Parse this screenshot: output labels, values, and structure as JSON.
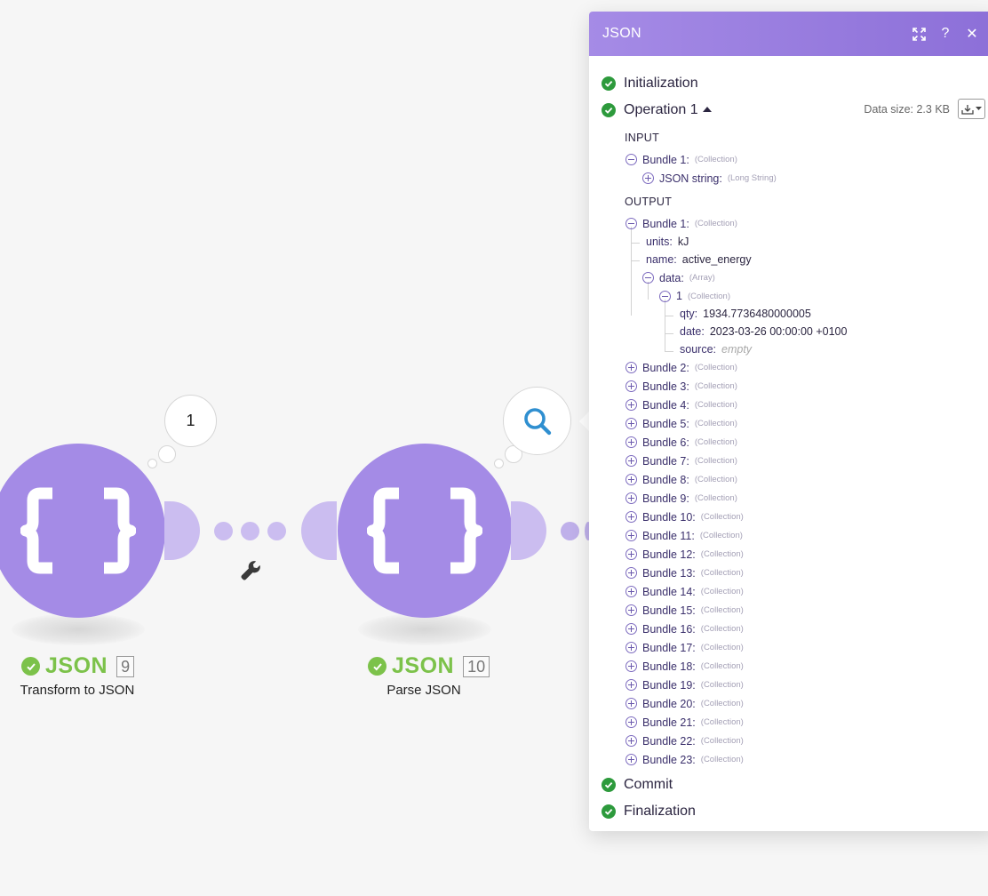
{
  "canvas": {
    "module1": {
      "title": "JSON",
      "id": "9",
      "subtitle": "Transform to JSON",
      "bubble_count": "1",
      "icon": "curly-braces-icon"
    },
    "module2": {
      "title": "JSON",
      "id": "10",
      "subtitle": "Parse JSON",
      "bubble_icon": "search-icon",
      "icon": "curly-braces-icon"
    },
    "filter_icon": "wrench-icon",
    "colors": {
      "module": "#a48be6",
      "success": "#7cc24a",
      "header": "#8c6fd8"
    }
  },
  "panel": {
    "title": "JSON",
    "header_icons": [
      "expand-icon",
      "help-icon",
      "close-icon"
    ],
    "help_label": "?",
    "close_label": "✕",
    "stages": {
      "initialization": "Initialization",
      "operation": "Operation 1",
      "commit": "Commit",
      "finalization": "Finalization"
    },
    "data_size": "Data size: 2.3 KB",
    "input": {
      "label": "INPUT",
      "bundle": {
        "key": "Bundle 1:",
        "type": "(Collection)"
      },
      "json_string": {
        "key": "JSON string:",
        "type": "(Long String)"
      }
    },
    "output": {
      "label": "OUTPUT",
      "bundle1": {
        "key": "Bundle 1:",
        "type": "(Collection)"
      },
      "units": {
        "key": "units:",
        "value": "kJ"
      },
      "name": {
        "key": "name:",
        "value": "active_energy"
      },
      "data": {
        "key": "data:",
        "type": "(Array)"
      },
      "item1": {
        "key": "1",
        "type": "(Collection)"
      },
      "qty": {
        "key": "qty:",
        "value": "1934.7736480000005"
      },
      "date": {
        "key": "date:",
        "value": "2023-03-26 00:00:00 +0100"
      },
      "source": {
        "key": "source:",
        "value": "empty"
      },
      "collapsed_bundles": [
        {
          "key": "Bundle 2:",
          "type": "(Collection)"
        },
        {
          "key": "Bundle 3:",
          "type": "(Collection)"
        },
        {
          "key": "Bundle 4:",
          "type": "(Collection)"
        },
        {
          "key": "Bundle 5:",
          "type": "(Collection)"
        },
        {
          "key": "Bundle 6:",
          "type": "(Collection)"
        },
        {
          "key": "Bundle 7:",
          "type": "(Collection)"
        },
        {
          "key": "Bundle 8:",
          "type": "(Collection)"
        },
        {
          "key": "Bundle 9:",
          "type": "(Collection)"
        },
        {
          "key": "Bundle 10:",
          "type": "(Collection)"
        },
        {
          "key": "Bundle 11:",
          "type": "(Collection)"
        },
        {
          "key": "Bundle 12:",
          "type": "(Collection)"
        },
        {
          "key": "Bundle 13:",
          "type": "(Collection)"
        },
        {
          "key": "Bundle 14:",
          "type": "(Collection)"
        },
        {
          "key": "Bundle 15:",
          "type": "(Collection)"
        },
        {
          "key": "Bundle 16:",
          "type": "(Collection)"
        },
        {
          "key": "Bundle 17:",
          "type": "(Collection)"
        },
        {
          "key": "Bundle 18:",
          "type": "(Collection)"
        },
        {
          "key": "Bundle 19:",
          "type": "(Collection)"
        },
        {
          "key": "Bundle 20:",
          "type": "(Collection)"
        },
        {
          "key": "Bundle 21:",
          "type": "(Collection)"
        },
        {
          "key": "Bundle 22:",
          "type": "(Collection)"
        },
        {
          "key": "Bundle 23:",
          "type": "(Collection)"
        }
      ]
    }
  }
}
